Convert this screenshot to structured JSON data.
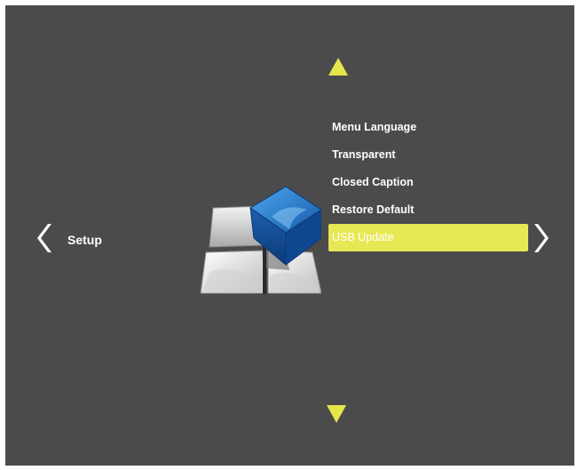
{
  "colors": {
    "background": "#4b4b4c",
    "accent": "#e8e856",
    "text": "#ffffff"
  },
  "category": {
    "label": "Setup",
    "icon": "setup-icon"
  },
  "navigation": {
    "up_icon": "triangle-up-icon",
    "down_icon": "triangle-down-icon",
    "left_icon": "chevron-left-icon",
    "right_icon": "chevron-right-icon"
  },
  "menu": {
    "items": [
      {
        "label": "Menu Language",
        "selected": false
      },
      {
        "label": "Transparent",
        "selected": false
      },
      {
        "label": "Closed Caption",
        "selected": false
      },
      {
        "label": "Restore Default",
        "selected": false
      },
      {
        "label": "USB Update",
        "selected": true
      }
    ]
  }
}
